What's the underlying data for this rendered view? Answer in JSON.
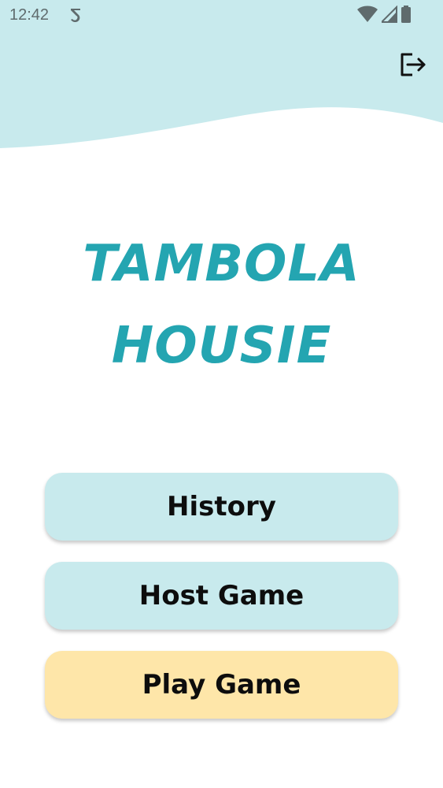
{
  "status_bar": {
    "time": "12:42",
    "icons": [
      "notification-icon",
      "wifi-icon",
      "signal-icon",
      "battery-icon"
    ]
  },
  "header": {
    "logout_icon": "logout-icon",
    "wave_color": "#c8eaed"
  },
  "title": {
    "line1": "TAMBOLA",
    "line2": "HOUSIE",
    "color": "#24a5b1"
  },
  "menu": {
    "history_label": "History",
    "host_game_label": "Host Game",
    "play_game_label": "Play Game",
    "primary_color": "#c8eaed",
    "accent_color": "#fee6a9"
  }
}
